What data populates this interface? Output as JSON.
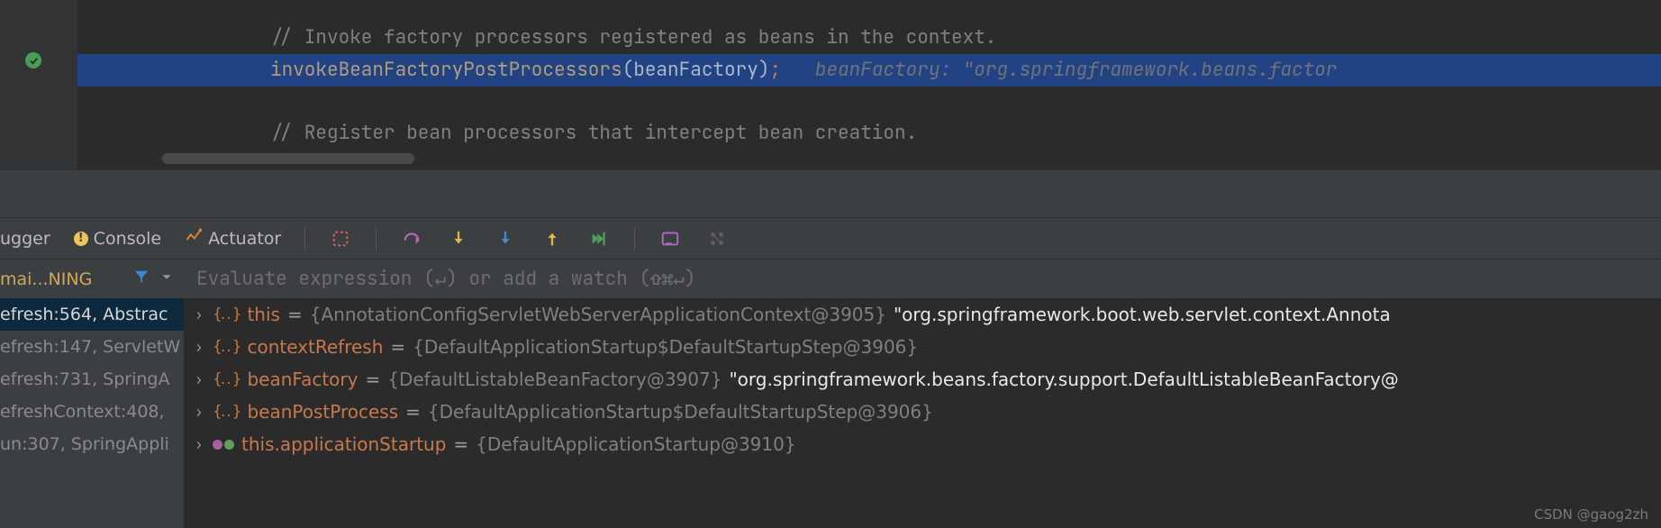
{
  "editor": {
    "lines": {
      "comment1": "// Invoke factory processors registered as beans in the context.",
      "call": "invokeBeanFactoryPostProcessors",
      "arg": "beanFactory",
      "semi": ";",
      "hint": "beanFactory: \"org.springframework.beans.factor",
      "comment2": "// Register bean processors that intercept bean creation."
    }
  },
  "toolbar": {
    "debugger_label": "ugger",
    "console_label": "Console",
    "actuator_label": "Actuator"
  },
  "watch": {
    "thread_label": "mai...NING",
    "placeholder": "Evaluate expression (↵) or add a watch (⇧⌘↵)"
  },
  "frames": [
    {
      "label": "efresh:564, Abstrac",
      "active": true
    },
    {
      "label": "efresh:147, ServletW",
      "active": false
    },
    {
      "label": "efresh:731, SpringA",
      "active": false
    },
    {
      "label": "efreshContext:408,",
      "active": false
    },
    {
      "label": "un:307, SpringAppli",
      "active": false
    }
  ],
  "vars": [
    {
      "badge": "obj",
      "name": "this",
      "type": "{AnnotationConfigServletWebServerApplicationContext@3905}",
      "str": " \"org.springframework.boot.web.servlet.context.Annota"
    },
    {
      "badge": "obj",
      "name": "contextRefresh",
      "type": "{DefaultApplicationStartup$DefaultStartupStep@3906}",
      "str": ""
    },
    {
      "badge": "obj",
      "name": "beanFactory",
      "type": "{DefaultListableBeanFactory@3907}",
      "str": " \"org.springframework.beans.factory.support.DefaultListableBeanFactory@"
    },
    {
      "badge": "obj",
      "name": "beanPostProcess",
      "type": "{DefaultApplicationStartup$DefaultStartupStep@3906}",
      "str": ""
    },
    {
      "badge": "glasses",
      "name": "this.applicationStartup",
      "type": "{DefaultApplicationStartup@3910}",
      "str": ""
    }
  ],
  "watermark": "CSDN @gaog2zh"
}
